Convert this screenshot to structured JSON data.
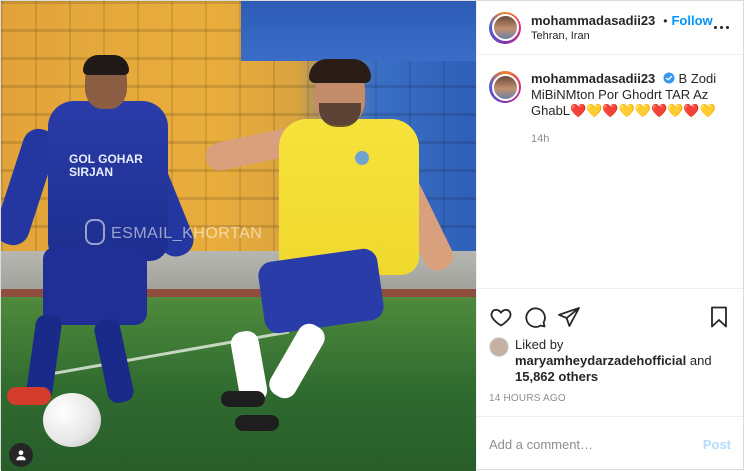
{
  "post": {
    "watermark": "ESMAIL_KHORTAN",
    "image_jersey_text": "GOL GOHAR SIRJAN",
    "header": {
      "username": "mohammadasadii23",
      "follow_label": "Follow",
      "separator": "•",
      "location": "Tehran, Iran"
    },
    "caption": {
      "username": "mohammadasadii23",
      "text": "B Zodi MiBiNMton Por Ghodrt TAR Az GhabL❤️💛❤️💛💛❤️💛❤️💛",
      "time": "14h"
    },
    "likes": {
      "prefix": "Liked by",
      "user": "maryamheydarzadehofficial",
      "and": "and",
      "count": "15,862 others"
    },
    "time_ago": "14 HOURS AGO",
    "add_comment": {
      "placeholder": "Add a comment…",
      "post_label": "Post"
    }
  },
  "colors": {
    "follow_blue": "#0095f6",
    "muted": "#8e8e8e",
    "post_disabled": "#b3dbff"
  },
  "icons": {
    "verified": "verified-badge-icon",
    "like": "heart-icon",
    "comment": "comment-bubble-icon",
    "share": "paper-plane-icon",
    "save": "bookmark-icon",
    "more": "more-options-icon",
    "tags": "user-tag-icon"
  }
}
